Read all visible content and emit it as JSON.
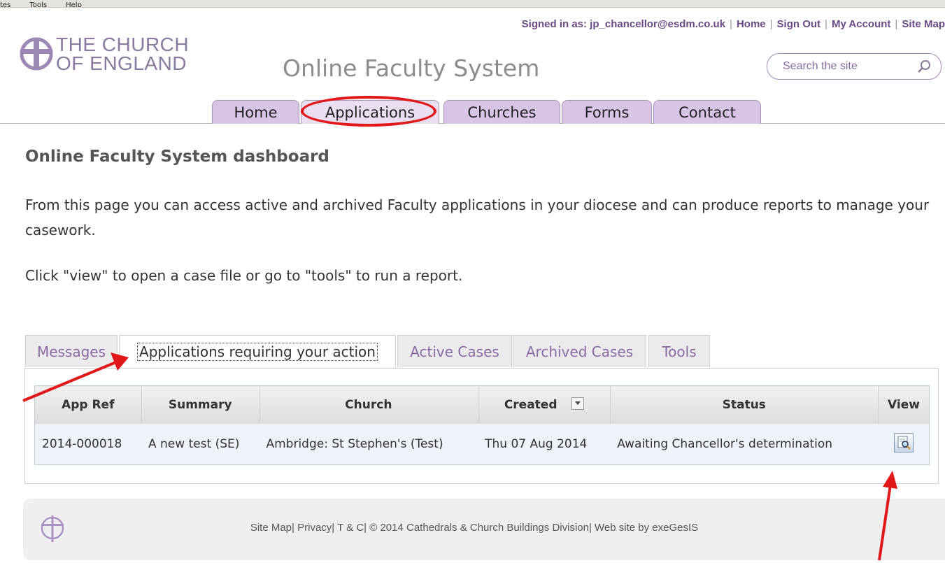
{
  "browser_menu": [
    "tes",
    "Tools",
    "Help"
  ],
  "topbar": {
    "signed_in": "Signed in as: jp_chancellor@esdm.co.uk",
    "links": [
      "Home",
      "Sign Out",
      "My Account",
      "Site Map"
    ]
  },
  "logo": {
    "line1": "THE CHURCH",
    "line2": "OF ENGLAND"
  },
  "site_title": "Online Faculty System",
  "search": {
    "placeholder": "Search the site"
  },
  "nav": [
    "Home",
    "Applications",
    "Churches",
    "Forms",
    "Contact"
  ],
  "page": {
    "title": "Online Faculty System dashboard",
    "intro": "From this page you can access active and archived Faculty applications in your diocese and can produce reports to manage your casework.",
    "instruction": "Click \"view\" to open a case file or go to \"tools\" to run a report."
  },
  "tabs": [
    "Messages",
    "Applications requiring your action",
    "Active Cases",
    "Archived Cases",
    "Tools"
  ],
  "table": {
    "headers": [
      "App Ref",
      "Summary",
      "Church",
      "Created",
      "Status",
      "View"
    ],
    "rows": [
      [
        "2014-000018",
        "A new test (SE)",
        "Ambridge: St Stephen's (Test)",
        "Thu 07 Aug 2014",
        "Awaiting Chancellor's determination"
      ]
    ]
  },
  "footer": {
    "links": [
      "Site Map",
      "Privacy",
      "T & C"
    ],
    "copyright": "© 2014 Cathedrals & Church Buildings Division",
    "credit": "Web site by exeGesIS"
  },
  "colors": {
    "accent": "#6b4a86",
    "tab_bg": "#d8c5e6",
    "annotation": "#e2171a"
  }
}
